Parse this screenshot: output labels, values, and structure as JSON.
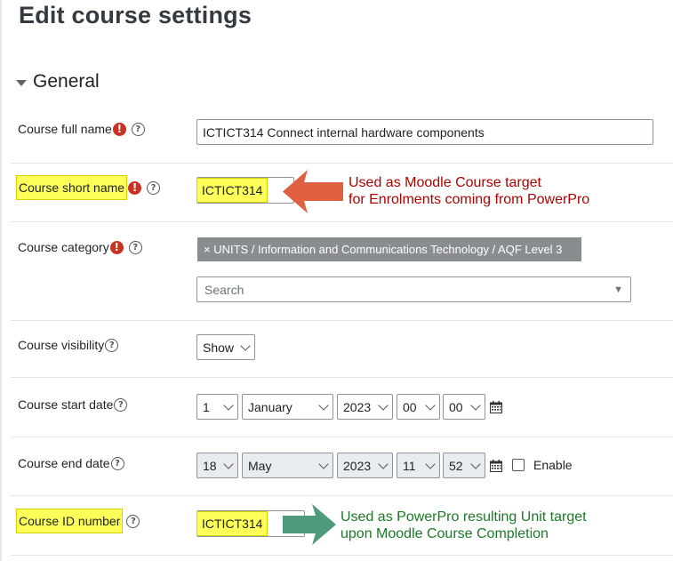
{
  "page": {
    "title": "Edit course settings"
  },
  "section": {
    "title": "General"
  },
  "fields": {
    "full_name": {
      "label": "Course full name",
      "value": "ICTICT314 Connect internal hardware components"
    },
    "short_name": {
      "label": "Course short name",
      "value": "ICTICT314"
    },
    "category": {
      "label": "Course category",
      "selected": "× UNITS / Information and Communications Technology / AQF Level 3",
      "search_placeholder": "Search"
    },
    "visibility": {
      "label": "Course visibility",
      "value": "Show"
    },
    "start_date": {
      "label": "Course start date",
      "day": "1",
      "month": "January",
      "year": "2023",
      "hour": "00",
      "minute": "00"
    },
    "end_date": {
      "label": "Course end date",
      "day": "18",
      "month": "May",
      "year": "2023",
      "hour": "11",
      "minute": "52",
      "enable_label": "Enable"
    },
    "id_number": {
      "label": "Course ID number",
      "value": "ICTICT314"
    }
  },
  "annotations": {
    "short_name": {
      "line1": "Used as Moodle Course target",
      "line2": "for Enrolments coming from PowerPro",
      "color": "#b10000",
      "arrow_color": "#e06040"
    },
    "id_number": {
      "line1": "Used as PowerPro resulting Unit target",
      "line2": "upon Moodle Course Completion",
      "color": "#1a7a26",
      "arrow_color": "#4f9a7a"
    }
  },
  "icons": {
    "required": "exclamation-circle-icon",
    "help": "question-circle-icon",
    "calendar": "calendar-icon",
    "collapse": "caret-down-icon"
  },
  "colors": {
    "required": "#ca3120",
    "highlight": "#ffff5a",
    "chip": "#8a8d90"
  }
}
